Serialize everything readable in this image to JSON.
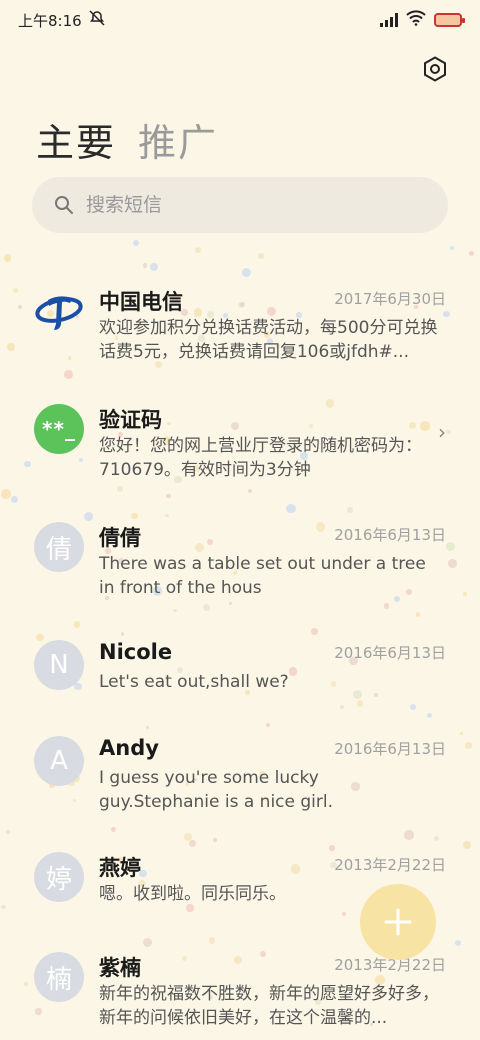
{
  "status_bar": {
    "time": "上午8:16",
    "icons": [
      "mute-icon",
      "signal-icon",
      "wifi-icon",
      "battery-icon"
    ]
  },
  "header": {
    "settings_icon": "settings-icon"
  },
  "tabs": [
    {
      "label": "主要",
      "active": true
    },
    {
      "label": "推广",
      "active": false
    }
  ],
  "search": {
    "placeholder": "搜索短信",
    "icon": "search-icon"
  },
  "messages": [
    {
      "avatar": "telecom-logo",
      "name": "中国电信",
      "date": "2017年6月30日",
      "preview": "欢迎参加积分兑换话费活动，每500分可兑换话费5元，兑换话费请回复106或jfdh#..."
    },
    {
      "avatar": "**_",
      "name": "验证码",
      "date": "",
      "preview": "您好！您的网上营业厅登录的随机密码为：710679。有效时间为3分钟"
    },
    {
      "avatar": "倩",
      "name": "倩倩",
      "date": "2016年6月13日",
      "preview": "There was a table set out under a tree in front of the hous"
    },
    {
      "avatar": "N",
      "name": "Nicole",
      "date": "2016年6月13日",
      "preview": "Let's eat out,shall we?"
    },
    {
      "avatar": "A",
      "name": "Andy",
      "date": "2016年6月13日",
      "preview": "I guess you're some lucky guy.Stephanie is a nice girl."
    },
    {
      "avatar": "婷",
      "name": "燕婷",
      "date": "2013年2月22日",
      "preview": "嗯。收到啦。同乐同乐。"
    },
    {
      "avatar": "楠",
      "name": "紫楠",
      "date": "2013年2月22日",
      "preview": "新年的祝福数不胜数，新年的愿望好多好多，新年的问候依旧美好，在这个温馨的..."
    }
  ],
  "fab": {
    "icon": "plus-icon"
  },
  "colors": {
    "background": "#fbf6e6",
    "fab": "#f7e4a4",
    "verify_avatar": "#5cc35a",
    "telecom_blue": "#1a4fa8"
  }
}
